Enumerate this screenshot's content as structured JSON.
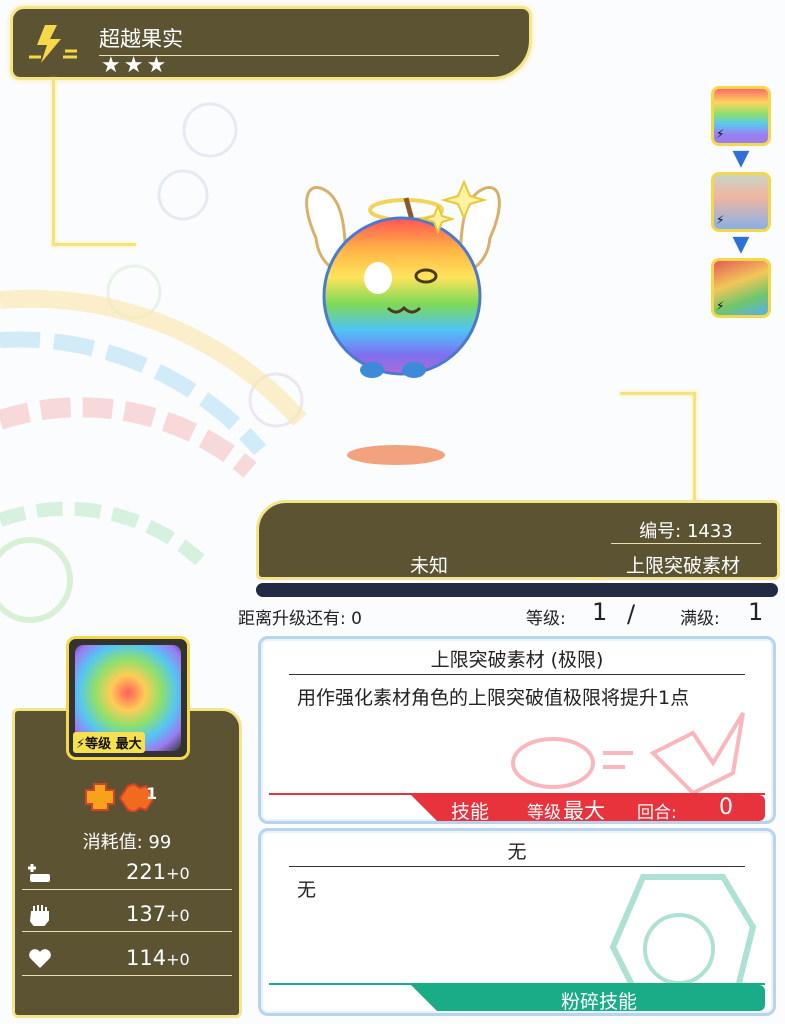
{
  "header": {
    "title": "超越果实",
    "stars": "★★★"
  },
  "info": {
    "number": "编号: 1433",
    "type": "未知",
    "material": "上限突破素材"
  },
  "level_row": {
    "exp_label": "距离升级还有: 0",
    "level_label": "等级:",
    "level_value": "1",
    "slash": "/",
    "max_label": "满级:",
    "max_value": "1"
  },
  "card": {
    "portrait_level": "等级 最大",
    "badge_num": "1",
    "cost": "消耗值: 99",
    "stats": [
      {
        "value": "221",
        "plus": "+0"
      },
      {
        "value": "137",
        "plus": "+0"
      },
      {
        "value": "114",
        "plus": "+0"
      }
    ]
  },
  "skill1": {
    "title": "上限突破素材 (极限)",
    "body": "用作强化素材角色的上限突破值极限将提升1点",
    "bar_label": "技能",
    "level_label": "等级",
    "level_value": "最大",
    "turn_label": "回合:",
    "turn_value": "0"
  },
  "skill2": {
    "title": "无",
    "body": "无",
    "bar_label": "粉碎技能"
  },
  "colors": {
    "panel": "#5b5332",
    "border": "#f4e58a",
    "skill_red": "#e8323c",
    "skill_green": "#1aab87"
  }
}
